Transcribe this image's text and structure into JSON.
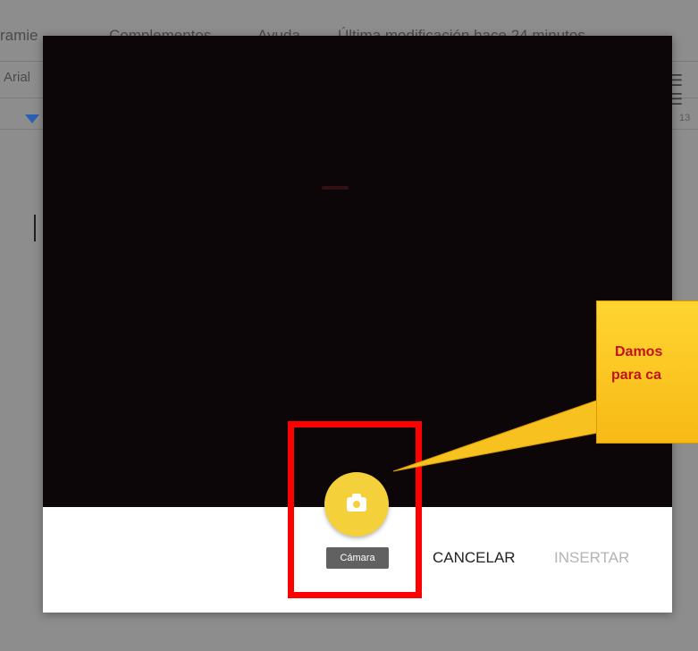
{
  "background": {
    "menu_items": [
      "ramie",
      "Complementos",
      "Ayuda",
      "Última modificación hace 24 minutos"
    ],
    "font_name": "Arial",
    "ruler_number": "13"
  },
  "dialog": {
    "camera_tooltip": "Cámara",
    "cancel_label": "CANCELAR",
    "insert_label": "INSERTAR",
    "camera_icon": "camera-icon"
  },
  "annotation": {
    "callout_line_1": "Damos",
    "callout_line_2": "para ca",
    "highlight_color": "#ff0000",
    "callout_color": "#ffd531",
    "callout_text_color": "#c0141a"
  },
  "colors": {
    "camera_button": "#f4d03a",
    "tooltip_bg": "#616161",
    "disabled_text": "#b4b4b4"
  }
}
